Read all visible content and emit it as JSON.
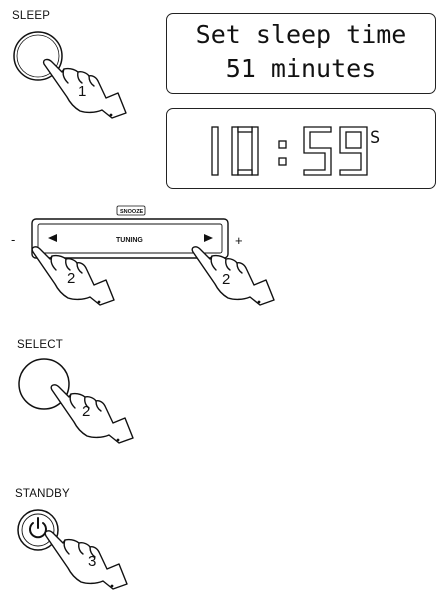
{
  "steps": {
    "sleep": {
      "label": "SLEEP",
      "number": "1"
    },
    "tuning": {
      "snooze_label": "SNOOZE",
      "tuning_label": "TUNING",
      "minus": "-",
      "plus": "+",
      "number": "2"
    },
    "select": {
      "label": "SELECT",
      "number": "2"
    },
    "standby": {
      "label": "STANDBY",
      "number": "3"
    }
  },
  "display_text": {
    "line1": "Set sleep time",
    "line2": "51 minutes"
  },
  "display_clock": {
    "time": "10:59",
    "seconds": "S"
  }
}
